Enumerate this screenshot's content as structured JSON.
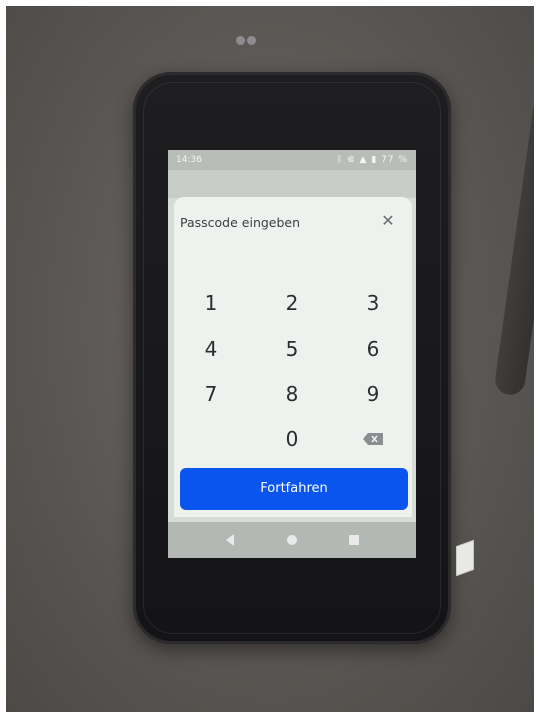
{
  "status_bar": {
    "time": "14:36",
    "icons": "ᛒ ⋐ ▲ ▮ 77 %"
  },
  "dialog": {
    "title": "Passcode eingeben",
    "close_icon": "close-icon"
  },
  "keypad": {
    "keys": [
      "1",
      "2",
      "3",
      "4",
      "5",
      "6",
      "7",
      "8",
      "9",
      "0"
    ],
    "backspace_icon": "backspace-icon"
  },
  "continue_button": {
    "label": "Fortfahren",
    "color": "#0a55f0"
  },
  "nav_bar": {
    "back_icon": "back-triangle-icon",
    "home_icon": "home-circle-icon",
    "recents_icon": "recents-square-icon"
  }
}
